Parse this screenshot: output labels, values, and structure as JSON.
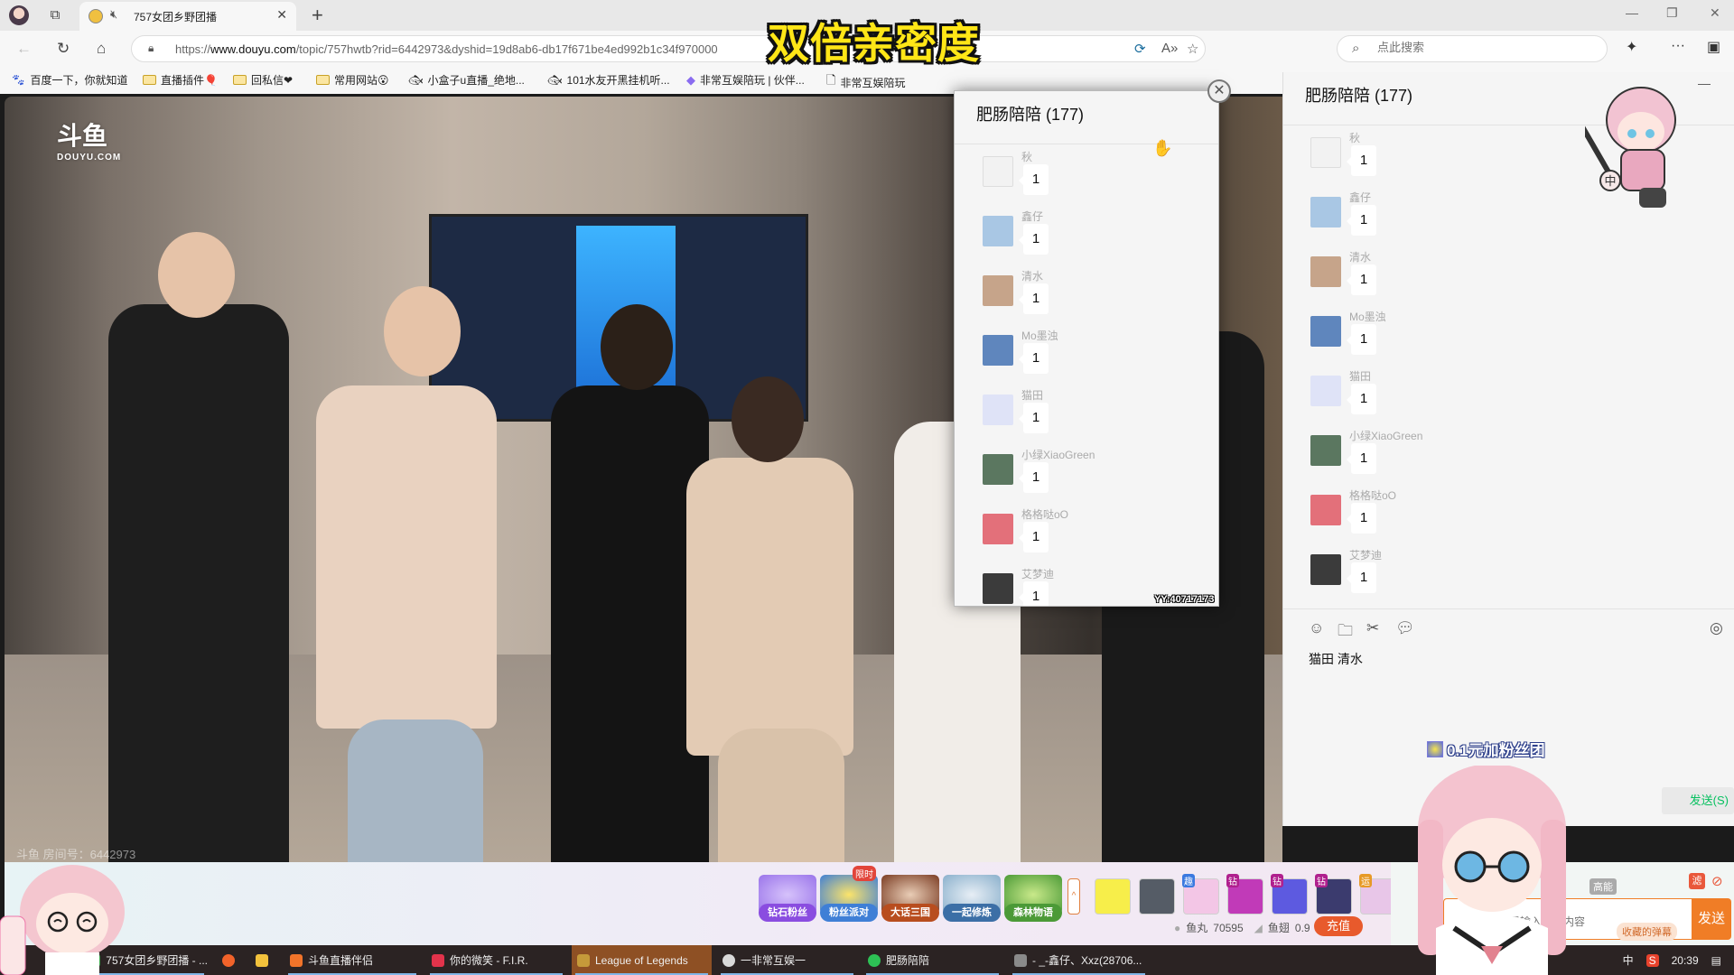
{
  "browser": {
    "tab_title": "757女团乡野团播",
    "url_prefix": "https://",
    "url_domain": "www.douyu.com",
    "url_rest": "/topic/757hwtb?rid=6442973&dyshid=19d8ab6-db17f671be4ed992b1c34f970000",
    "search_placeholder": "点此搜索",
    "bookmarks": [
      {
        "label": "百度一下，你就知道",
        "icon": "baidu-paw-icon"
      },
      {
        "label": "直播插件🎈",
        "icon": "folder-icon"
      },
      {
        "label": "回私信❤",
        "icon": "folder-icon"
      },
      {
        "label": "常用网站😮",
        "icon": "folder-icon"
      },
      {
        "label": "小盒子u直播_绝地...",
        "icon": "site-favicon"
      },
      {
        "label": "101水友开黑挂机听...",
        "icon": "site-favicon"
      },
      {
        "label": "非常互娱陪玩 | 伙伴...",
        "icon": "diamond-favicon"
      },
      {
        "label": "非常互娱陪玩",
        "icon": "page-icon"
      }
    ]
  },
  "overlay": {
    "headline": "双倍亲密度"
  },
  "video": {
    "logo": "斗鱼",
    "logo_sub": "DOUYU.COM",
    "room_label": "斗鱼 房间号：6442973"
  },
  "gifts": {
    "featured": [
      {
        "label": "钻石粉丝",
        "color": "#8a4de0"
      },
      {
        "label": "粉丝派对",
        "color": "#3f7fd6",
        "badge": "限时"
      },
      {
        "label": "大话三国",
        "color": "#b84d1e"
      },
      {
        "label": "一起修炼",
        "color": "#3c6fa6"
      },
      {
        "label": "森林物语",
        "color": "#4b9a37"
      }
    ],
    "items": [
      {
        "tag": "",
        "color": "#f7ee4a"
      },
      {
        "tag": "",
        "color": "#555c66"
      },
      {
        "tag": "趣",
        "color": "#f3c6e6"
      },
      {
        "tag": "钻",
        "color": "#c13ab8"
      },
      {
        "tag": "钻",
        "color": "#5d5ae0"
      },
      {
        "tag": "钻",
        "color": "#3b3b6e"
      },
      {
        "tag": "运",
        "color": "#e8c6e8"
      }
    ],
    "expand_icon": "^",
    "balance_yuwan_label": "鱼丸",
    "balance_yuwan": "70595",
    "balance_yuchi_label": "鱼翅",
    "balance_yuchi": "0.9",
    "recharge_label": "充值"
  },
  "danmaku": {
    "gaoneng_label": "高能",
    "filter_label": "滤",
    "placeholder": "这里输入弹幕内容",
    "favorites_label": "收藏的弹幕",
    "send_label": "发送"
  },
  "group_chat": {
    "title": "肥肠陪陪 (177)",
    "messages": [
      {
        "name": "秋",
        "text": "1",
        "avatar_color": "#f2f2f2"
      },
      {
        "name": "鑫仔",
        "text": "1",
        "avatar_color": "#a9c7e4"
      },
      {
        "name": "清水",
        "text": "1",
        "avatar_color": "#c6a48a"
      },
      {
        "name": "Mo墨浊",
        "text": "1",
        "avatar_color": "#5f86bd"
      },
      {
        "name": "猫田",
        "text": "1",
        "avatar_color": "#dfe3f7"
      },
      {
        "name": "小绿XiaoGreen",
        "text": "1",
        "avatar_color": "#5b7760"
      },
      {
        "name": "格格哒oO",
        "text": "1",
        "avatar_color": "#e3707a"
      },
      {
        "name": "艾梦迪",
        "text": "1",
        "avatar_color": "#3b3b3b"
      }
    ],
    "watermark": "YY:40717173",
    "input_text": "猫田 清水",
    "send_label": "发送(S)",
    "fans_banner": "0.1元加粉丝团",
    "sticker_badge": "中"
  },
  "taskbar": {
    "items": [
      {
        "label": "757女团乡野团播 - ...",
        "icon_color": "#3aa64a"
      },
      {
        "label": "",
        "icon_color": "#f2632a"
      },
      {
        "label": "",
        "icon_color": "#f3c23c"
      },
      {
        "label": "斗鱼直播伴侣",
        "icon_color": "#f2742a"
      },
      {
        "label": "你的微笑 - F.I.R.",
        "icon_color": "#e2334b"
      },
      {
        "label": "League of Legends",
        "icon_color": "#c59a3a"
      },
      {
        "label": "一非常互娱一",
        "icon_color": "#d9d9d9"
      },
      {
        "label": "肥肠陪陪",
        "icon_color": "#2dc155"
      },
      {
        "label": "- _-鑫仔、Xxz(28706...",
        "icon_color": "#8a8a8a"
      }
    ],
    "ime": "中",
    "clock": "20:39"
  }
}
